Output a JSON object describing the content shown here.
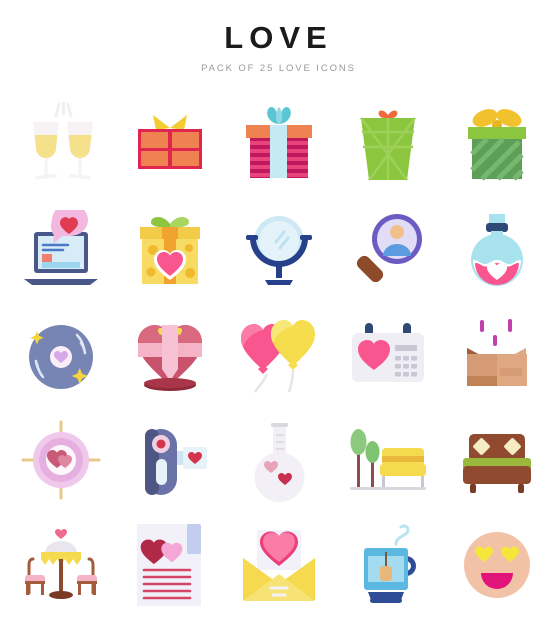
{
  "header": {
    "title": "LOVE",
    "subtitle": "PACK OF 25 LOVE ICONS"
  },
  "colors": {
    "title": "#1b1b1b",
    "subtitle": "#9a9a9a",
    "background": "#ffffff",
    "pink": "#f9568f",
    "hot_pink": "#ec3e78",
    "yellow": "#f6d743",
    "green": "#8cc63f",
    "orange": "#ef7f4a",
    "red": "#e0264f",
    "blue": "#3f4f8f",
    "light_blue": "#9fdcef",
    "brown": "#8f4a2f",
    "lavender": "#e5b5e0"
  },
  "icons": [
    {
      "index": 1,
      "name": "champagne-toast-icon",
      "label": "Champagne Toast"
    },
    {
      "index": 2,
      "name": "gift-box-red-icon",
      "label": "Red Gift Box"
    },
    {
      "index": 3,
      "name": "gift-box-striped-icon",
      "label": "Striped Gift Box"
    },
    {
      "index": 4,
      "name": "gift-bag-green-icon",
      "label": "Green Gift Bag"
    },
    {
      "index": 5,
      "name": "gift-box-green-icon",
      "label": "Green Gift Box"
    },
    {
      "index": 6,
      "name": "laptop-love-chat-icon",
      "label": "Laptop Love Chat"
    },
    {
      "index": 7,
      "name": "gift-box-heart-icon",
      "label": "Heart Gift Box"
    },
    {
      "index": 8,
      "name": "mirror-icon",
      "label": "Mirror"
    },
    {
      "index": 9,
      "name": "search-partner-icon",
      "label": "Search Partner"
    },
    {
      "index": 10,
      "name": "love-potion-icon",
      "label": "Love Potion"
    },
    {
      "index": 11,
      "name": "vinyl-record-icon",
      "label": "Love Song Record"
    },
    {
      "index": 12,
      "name": "heart-plant-pot-icon",
      "label": "Heart Plant Pot"
    },
    {
      "index": 13,
      "name": "heart-balloons-icon",
      "label": "Heart Balloons"
    },
    {
      "index": 14,
      "name": "calendar-heart-icon",
      "label": "Love Calendar"
    },
    {
      "index": 15,
      "name": "open-box-icon",
      "label": "Open Box"
    },
    {
      "index": 16,
      "name": "love-target-icon",
      "label": "Love Target"
    },
    {
      "index": 17,
      "name": "video-camera-love-icon",
      "label": "Love Video Camera"
    },
    {
      "index": 18,
      "name": "love-flask-icon",
      "label": "Love Flask"
    },
    {
      "index": 19,
      "name": "park-bench-icon",
      "label": "Park Bench"
    },
    {
      "index": 20,
      "name": "double-bed-icon",
      "label": "Double Bed"
    },
    {
      "index": 21,
      "name": "romantic-dinner-icon",
      "label": "Romantic Dinner"
    },
    {
      "index": 22,
      "name": "love-letter-page-icon",
      "label": "Love Letter Page"
    },
    {
      "index": 23,
      "name": "love-envelope-icon",
      "label": "Love Envelope"
    },
    {
      "index": 24,
      "name": "tea-cup-icon",
      "label": "Tea Cup"
    },
    {
      "index": 25,
      "name": "heart-eyes-emoji-icon",
      "label": "Heart Eyes Emoji"
    }
  ]
}
